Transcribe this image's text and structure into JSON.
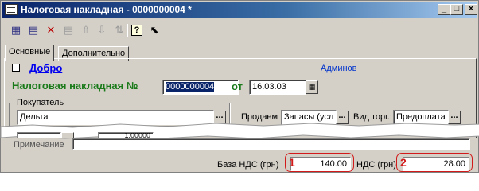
{
  "window": {
    "title": "Налоговая накладная - 0000000004 *",
    "minimize": "_",
    "maximize": "□",
    "close": "×"
  },
  "toolbar": {
    "icons": [
      "table-icon",
      "add-row-icon",
      "delete-row-icon",
      "copy-icon",
      "up-arrow-icon",
      "down-arrow-icon",
      "sort-icon",
      "help-icon",
      "pointer-help-icon"
    ]
  },
  "tabs": [
    {
      "label": "Основные"
    },
    {
      "label": "Дополнительно"
    }
  ],
  "header": {
    "firm_link": "Добро",
    "admin_label": "Админов",
    "doc_title": "Налоговая накладная №",
    "doc_number": "0000000004",
    "from_label": "от",
    "doc_date": "16.03.03"
  },
  "buyer": {
    "group_label": "Покупатель",
    "value": "Дельта"
  },
  "sale": {
    "sell_label": "Продаем",
    "sell_value": "Запасы (усл",
    "trade_type_label": "Вид торг.:",
    "trade_type_value": "Предоплата"
  },
  "partial": {
    "row_value": "1,00000",
    "note_label": "Примечание"
  },
  "totals": {
    "vat_base_label": "База НДС (грн)",
    "vat_base_value": "140.00",
    "vat_label": "НДС (грн)",
    "vat_value": "28.00",
    "marker_1": "1",
    "marker_2": "2"
  },
  "colors": {
    "title_start": "#0a246a",
    "highlight_red": "#d21a1a",
    "heading_green": "#1a7a1a",
    "link_blue": "#0000ee"
  }
}
